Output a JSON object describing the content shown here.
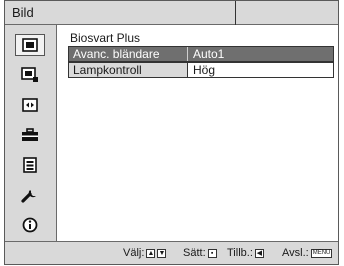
{
  "window": {
    "title": "Bild"
  },
  "sidebar": {
    "items": [
      {
        "icon": "picture-icon",
        "selected": true
      },
      {
        "icon": "advanced-picture-icon",
        "selected": false
      },
      {
        "icon": "screen-icon",
        "selected": false
      },
      {
        "icon": "setup-toolbox-icon",
        "selected": false
      },
      {
        "icon": "menu-list-icon",
        "selected": false
      },
      {
        "icon": "wrench-icon",
        "selected": false
      },
      {
        "icon": "information-icon",
        "selected": false
      }
    ]
  },
  "main": {
    "section_title": "Biosvart Plus",
    "rows": [
      {
        "label": "Avanc. bländare",
        "value": "Auto1",
        "selected": true
      },
      {
        "label": "Lampkontroll",
        "value": "Hög",
        "selected": false
      }
    ]
  },
  "statusbar": {
    "select_label": "Välj:",
    "set_label": "Sätt:",
    "back_label": "Tillb.:",
    "exit_label": "Avsl.:",
    "menu_key_label": "MENU"
  }
}
